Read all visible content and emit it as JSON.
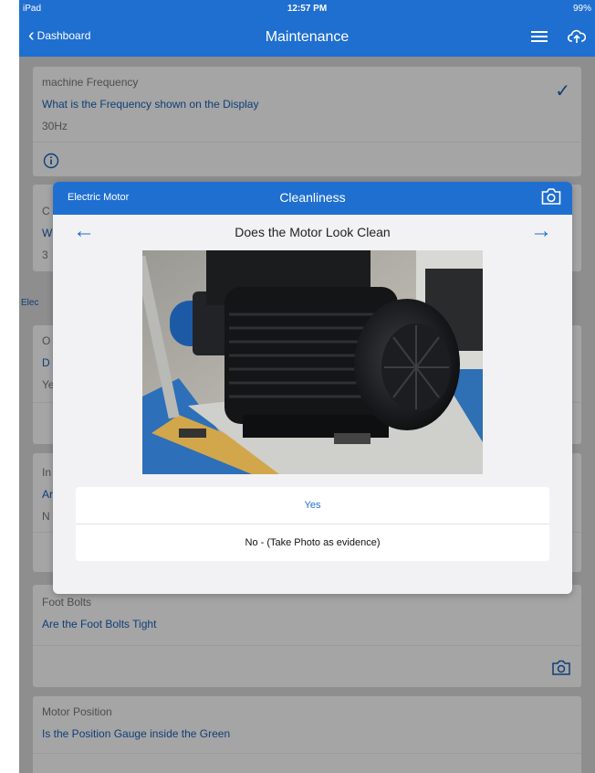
{
  "status": {
    "device": "iPad",
    "time": "12:57 PM",
    "battery": "99%"
  },
  "nav": {
    "back_label": "Dashboard",
    "title": "Maintenance"
  },
  "cards": [
    {
      "label": "machine Frequency",
      "question": "What is the Frequency shown on the Display",
      "answer": "30Hz"
    },
    {
      "label": "C",
      "question": "W",
      "answer": "3"
    },
    {
      "label": "O",
      "question": "D",
      "answer": "Ye"
    },
    {
      "label": "In",
      "question": "Ar",
      "answer": "N"
    },
    {
      "label": "Foot Bolts",
      "question": "Are the Foot Bolts Tight"
    },
    {
      "label": "Motor Position",
      "question": "Is the Position Gauge inside the Green"
    }
  ],
  "section_label": "Elec",
  "modal": {
    "category": "Electric Motor",
    "title": "Cleanliness",
    "question": "Does the Motor Look Clean",
    "options": [
      "Yes",
      "No - (Take Photo as evidence)"
    ]
  },
  "colors": {
    "accent": "#1f6fd0",
    "dim_text": "#0f3e78"
  },
  "icons": [
    "back-chevron-icon",
    "list-icon",
    "upload-icon",
    "check-icon",
    "info-icon",
    "camera-icon",
    "arrow-left-icon",
    "arrow-right-icon"
  ]
}
